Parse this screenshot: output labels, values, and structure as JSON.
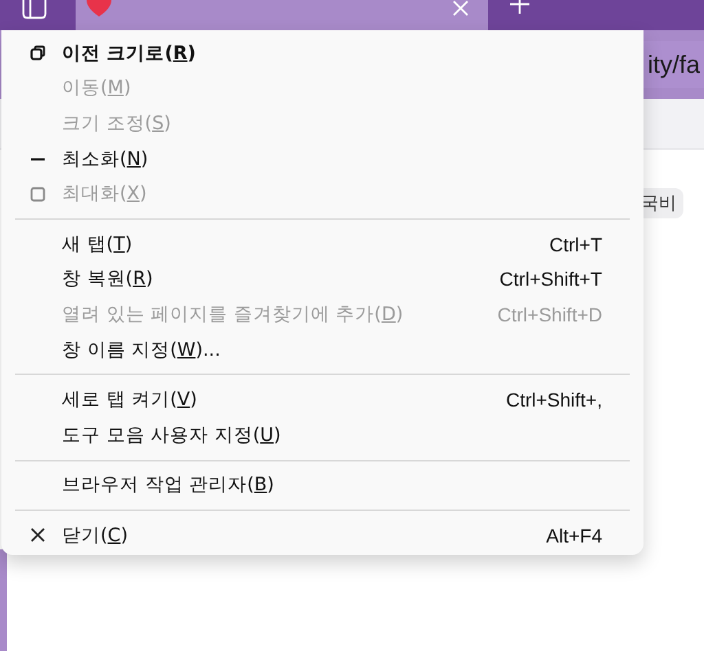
{
  "address_bar": {
    "url": "ity/fa"
  },
  "page": {
    "tag": "국비"
  },
  "context_menu": {
    "items": [
      {
        "kind": "restore",
        "label": "이전 크기로",
        "mnemonic": "(R)",
        "default": true,
        "disabled": false
      },
      {
        "kind": "item",
        "label": "이동",
        "mnemonic": "(M)",
        "default": false,
        "disabled": true
      },
      {
        "kind": "item",
        "label": "크기 조정",
        "mnemonic": "(S)",
        "default": false,
        "disabled": true
      },
      {
        "kind": "minimize",
        "label": "최소화",
        "mnemonic": "(N)",
        "default": false,
        "disabled": false
      },
      {
        "kind": "maximize",
        "label": "최대화",
        "mnemonic": "(X)",
        "default": false,
        "disabled": true
      },
      {
        "kind": "separator"
      },
      {
        "kind": "item",
        "label": "새 탭",
        "mnemonic": "(T)",
        "shortcut": "Ctrl+T",
        "default": false,
        "disabled": false
      },
      {
        "kind": "item",
        "label": "창 복원",
        "mnemonic": "(R)",
        "shortcut": "Ctrl+Shift+T",
        "default": false,
        "disabled": false
      },
      {
        "kind": "item",
        "label": "열려 있는 페이지를 즐겨찾기에 추가",
        "mnemonic": "(D)",
        "shortcut": "Ctrl+Shift+D",
        "default": false,
        "disabled": true
      },
      {
        "kind": "item",
        "label": "창 이름 지정",
        "mnemonic": "(W)",
        "suffix": "...",
        "default": false,
        "disabled": false
      },
      {
        "kind": "separator"
      },
      {
        "kind": "item",
        "label": "세로 탭 켜기",
        "mnemonic": "(V)",
        "shortcut": "Ctrl+Shift+,",
        "default": false,
        "disabled": false
      },
      {
        "kind": "item",
        "label": "도구 모음 사용자 지정",
        "mnemonic": "(U)",
        "default": false,
        "disabled": false
      },
      {
        "kind": "separator"
      },
      {
        "kind": "item",
        "label": "브라우저 작업 관리자",
        "mnemonic": "(B)",
        "default": false,
        "disabled": false
      },
      {
        "kind": "separator"
      },
      {
        "kind": "close",
        "label": "닫기",
        "mnemonic": "(C)",
        "shortcut": "Alt+F4",
        "default": false,
        "disabled": false
      }
    ]
  }
}
